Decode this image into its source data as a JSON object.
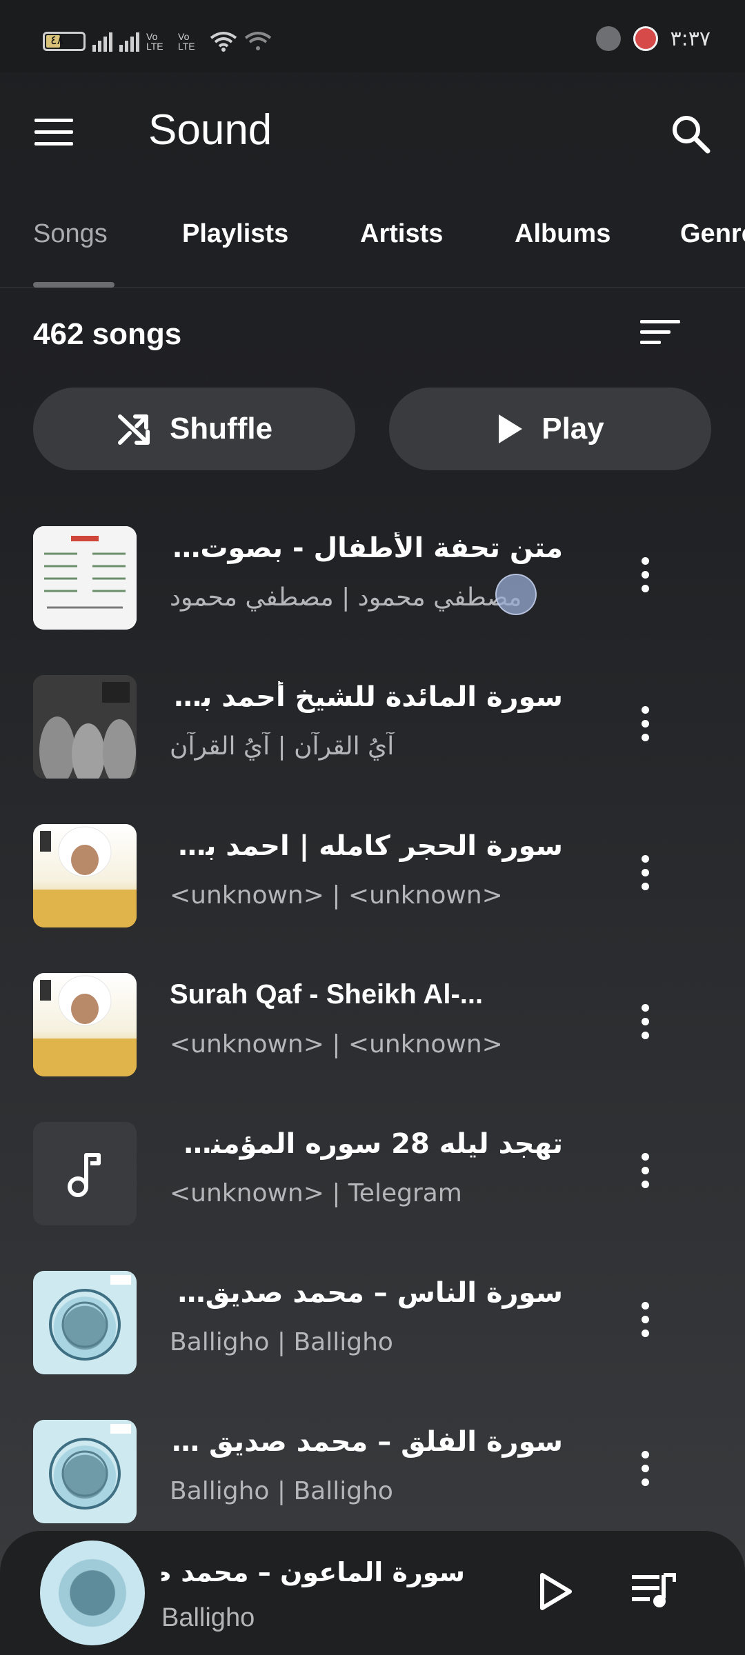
{
  "status_bar": {
    "battery_level": "٤٨",
    "volte_1": "Vo LTE",
    "volte_2": "Vo LTE",
    "time": "٣:٣٧"
  },
  "app_bar": {
    "title": "Sound",
    "menu_icon": "hamburger-menu-icon",
    "search_icon": "search-icon"
  },
  "tabs": [
    {
      "label": "Songs",
      "active": true
    },
    {
      "label": "Playlists",
      "active": false
    },
    {
      "label": "Artists",
      "active": false
    },
    {
      "label": "Albums",
      "active": false
    },
    {
      "label": "Genre",
      "active": false
    }
  ],
  "summary": {
    "song_count": "462 songs"
  },
  "actions": {
    "shuffle_label": "Shuffle",
    "play_label": "Play"
  },
  "songs": [
    {
      "title": "متن تحفة الأطفال - بصوت ...",
      "subtitle": "مصطفي محمود | مصطفي محمود",
      "art": "sheet"
    },
    {
      "title": "سورة المائدة للشيخ أحمد بـ...",
      "subtitle": "آيُ القرآن | آيُ القرآن",
      "art": "mosque"
    },
    {
      "title": "سورة الحجر كامله | احمد بـ...",
      "subtitle": "<unknown> | <unknown>",
      "art": "sheikh"
    },
    {
      "title": "Surah Qaf - Sheikh Al-...",
      "subtitle": "<unknown> | <unknown>",
      "art": "sheikh"
    },
    {
      "title": "تهجد ليله 28 سوره المؤمنو...",
      "subtitle": "<unknown> | Telegram",
      "art": "music"
    },
    {
      "title": "سورة الناس – محمد صديق ...",
      "subtitle": "Balligho | Balligho",
      "art": "pattern"
    },
    {
      "title": "سورة الفلق – محمد صديق ا...",
      "subtitle": "Balligho | Balligho",
      "art": "pattern"
    }
  ],
  "now_playing": {
    "title": "سورة الماعون – محمد ص...",
    "subtitle": "Balligho"
  },
  "colors": {
    "background": "#202124",
    "button": "#3a3b3e",
    "secondary_text": "#b4b6b9",
    "inactive_tab": "#a9abae"
  }
}
